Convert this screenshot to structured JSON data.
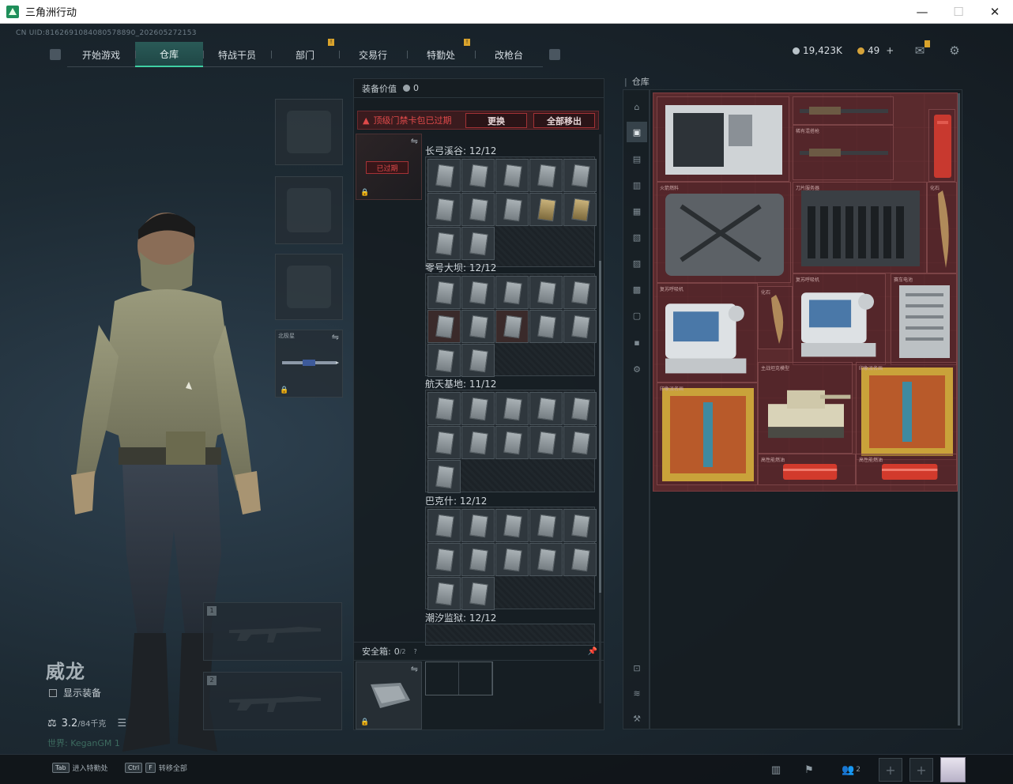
{
  "window": {
    "title": "三角洲行动",
    "min_glyph": "—",
    "max_glyph": "☐",
    "close_glyph": "✕"
  },
  "header": {
    "uid": "CN UID:8162691084080578890_202605272153",
    "tabs": [
      {
        "label": "开始游戏",
        "active": false,
        "notice": false
      },
      {
        "label": "仓库",
        "active": true,
        "notice": false
      },
      {
        "label": "特战干员",
        "active": false,
        "notice": false
      },
      {
        "label": "部门",
        "active": false,
        "notice": true
      },
      {
        "label": "交易行",
        "active": false,
        "notice": false
      },
      {
        "label": "特勤处",
        "active": false,
        "notice": true
      },
      {
        "label": "改枪台",
        "active": false,
        "notice": false
      }
    ],
    "notice_glyph": "!",
    "currency_silver": "19,423K",
    "currency_gold": "49",
    "add_glyph": "+",
    "colors": {
      "accent": "#3fd0a4",
      "notice": "#d9a32c",
      "alert": "#e04a4a",
      "stash_bg": "#5a2a2d"
    }
  },
  "loadout": {
    "backpack_label": "北极星",
    "swap_glyph": "⇋",
    "lock_glyph": "🔒",
    "weapon_slot_1": "1",
    "weapon_slot_2": "2"
  },
  "operator": {
    "name": "威龙",
    "show_equipment_label": "显示装备",
    "weight_value": "3.2",
    "weight_capacity": "/84千克",
    "watermark": "世界: KeganGM 1"
  },
  "middle": {
    "equip_value_label": "装备价值",
    "equip_value": "0",
    "expired_warning": "顶级门禁卡包已过期",
    "replace_button": "更换",
    "remove_all_button": "全部移出",
    "expired_tag": "已过期",
    "sections": [
      {
        "title": "长弓溪谷: 12/12",
        "cards": 12
      },
      {
        "title": "零号大坝: 12/12",
        "cards": 12
      },
      {
        "title": "航天基地: 11/12",
        "cards": 11
      },
      {
        "title": "巴克什: 12/12",
        "cards": 12
      },
      {
        "title": "潮汐监狱: 12/12",
        "cards": 12
      }
    ],
    "safe_box_label": "安全箱:",
    "safe_box_count": "0",
    "safe_box_capacity": "/2",
    "help_glyph": "?",
    "pin_glyph": "📌"
  },
  "stash": {
    "title": "仓库",
    "items": [
      {
        "label": "",
        "icon": "server-rack"
      },
      {
        "label": "",
        "icon": "rifle-ornate"
      },
      {
        "label": "稀有混搭枪",
        "icon": "rifle-ornate"
      },
      {
        "label": "",
        "icon": "red-case"
      },
      {
        "label": "刀片服务器",
        "icon": "blade-server"
      },
      {
        "label": "火箭燃料",
        "icon": "fuel-canister"
      },
      {
        "label": "化石",
        "icon": "claw-fossil"
      },
      {
        "label": "复苏呼吸机",
        "icon": "medical-device"
      },
      {
        "label": "赛车电池",
        "icon": "battery"
      },
      {
        "label": "复苏呼吸机",
        "icon": "medical-device"
      },
      {
        "label": "化石",
        "icon": "claw-fossil"
      },
      {
        "label": "主战坦克模型",
        "icon": "tank-model"
      },
      {
        "label": "印象派名画",
        "icon": "painting"
      },
      {
        "label": "印象派名画",
        "icon": "painting"
      },
      {
        "label": "高性能燃油",
        "icon": "fuel-box"
      },
      {
        "label": "高性能燃油",
        "icon": "fuel-box"
      }
    ]
  },
  "bottom": {
    "hint1_key": "Tab",
    "hint1_text": "进入特勤处",
    "hint2_key1": "Ctrl",
    "hint2_key2": "F",
    "hint2_text": "转移全部",
    "team_count": "2",
    "add_glyph": "+"
  }
}
